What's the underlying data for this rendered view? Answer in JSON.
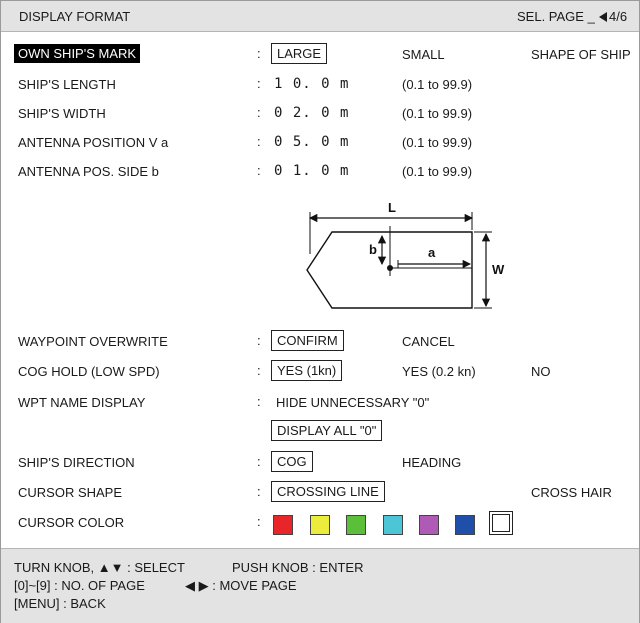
{
  "header": {
    "title": "DISPLAY FORMAT",
    "sel_page": "SEL. PAGE _",
    "page_num": "4/6"
  },
  "rows": {
    "own_ship_mark": {
      "label": "OWN SHIP'S MARK",
      "selected": "LARGE",
      "opt2": "SMALL",
      "opt3": "SHAPE OF SHIP"
    },
    "ship_length": {
      "label": "SHIP'S LENGTH",
      "value": "1 0. 0 m",
      "range": "(0.1 to 99.9)"
    },
    "ship_width": {
      "label": "SHIP'S WIDTH",
      "value": "0 2. 0 m",
      "range": "(0.1 to 99.9)"
    },
    "antenna_v": {
      "label": "ANTENNA POSITION V a",
      "value": "0 5. 0 m",
      "range": "(0.1 to 99.9)"
    },
    "antenna_side": {
      "label": "ANTENNA POS. SIDE b",
      "value": "0 1. 0 m",
      "range": "(0.1 to 99.9)"
    },
    "waypoint_overwrite": {
      "label": "WAYPOINT OVERWRITE",
      "selected": "CONFIRM",
      "opt2": "CANCEL"
    },
    "cog_hold": {
      "label": "COG HOLD (LOW SPD)",
      "selected": "YES (1kn)",
      "opt2": "YES (0.2 kn)",
      "opt3": "NO"
    },
    "wpt_name": {
      "label": "WPT NAME DISPLAY",
      "opt1": "HIDE UNNECESSARY \"0\"",
      "selected": "DISPLAY ALL \"0\""
    },
    "ship_direction": {
      "label": "SHIP'S DIRECTION",
      "selected": "COG",
      "opt2": "HEADING"
    },
    "cursor_shape": {
      "label": "CURSOR SHAPE",
      "selected": "CROSSING LINE",
      "opt2": "CROSS HAIR"
    },
    "cursor_color": {
      "label": "CURSOR COLOR"
    }
  },
  "colon": ":",
  "diagram": {
    "L": "L",
    "W": "W",
    "a": "a",
    "b": "b"
  },
  "cursor_colors": [
    "#e8262a",
    "#ecec3c",
    "#5bbf3a",
    "#4cc6d6",
    "#b05ab8",
    "#1f4fa8",
    "#ffffff"
  ],
  "footer": {
    "line1_a": "TURN KNOB, ▲▼ : SELECT",
    "line1_b": "PUSH KNOB : ENTER",
    "line2_a": "[0]~[9] : NO. OF PAGE",
    "line2_b": "◀ ▶ : MOVE PAGE",
    "line3": "[MENU] : BACK"
  }
}
